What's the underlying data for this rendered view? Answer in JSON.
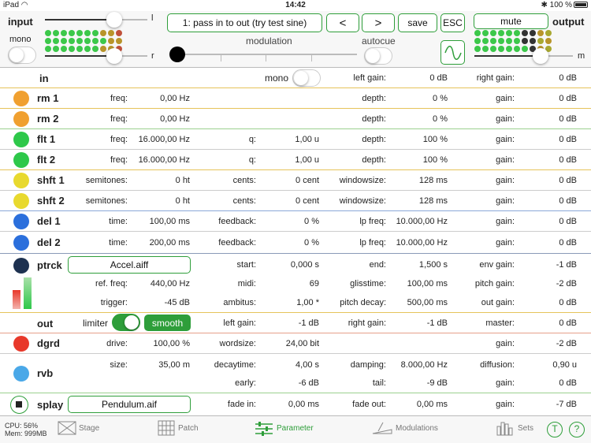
{
  "status": {
    "device": "iPad",
    "time": "14:42",
    "battery": "100 %"
  },
  "top": {
    "input_label": "input",
    "mono_label": "mono",
    "l": "l",
    "r": "r",
    "preset": "1: pass in to out (try test sine)",
    "prev": "<",
    "next": ">",
    "save": "save",
    "esc": "ESC",
    "modulation": "modulation",
    "autocue": "autocue",
    "mute": "mute",
    "output": "output",
    "m": "m",
    "colors": {
      "accent": "#2e9e3a"
    }
  },
  "rows": {
    "in": {
      "name": "in",
      "mono": "mono",
      "lg_l": "left gain:",
      "lg_v": "0 dB",
      "rg_l": "right gain:",
      "rg_v": "0 dB"
    },
    "rm1": {
      "name": "rm 1",
      "a_l": "freq:",
      "a_v": "0,00 Hz",
      "c_l": "depth:",
      "c_v": "0 %",
      "d_l": "gain:",
      "d_v": "0 dB"
    },
    "rm2": {
      "name": "rm 2",
      "a_l": "freq:",
      "a_v": "0,00 Hz",
      "c_l": "depth:",
      "c_v": "0 %",
      "d_l": "gain:",
      "d_v": "0 dB"
    },
    "flt1": {
      "name": "flt 1",
      "a_l": "freq:",
      "a_v": "16.000,00 Hz",
      "b_l": "q:",
      "b_v": "1,00 u",
      "c_l": "depth:",
      "c_v": "100 %",
      "d_l": "gain:",
      "d_v": "0 dB"
    },
    "flt2": {
      "name": "flt 2",
      "a_l": "freq:",
      "a_v": "16.000,00 Hz",
      "b_l": "q:",
      "b_v": "1,00 u",
      "c_l": "depth:",
      "c_v": "100 %",
      "d_l": "gain:",
      "d_v": "0 dB"
    },
    "shft1": {
      "name": "shft 1",
      "a_l": "semitones:",
      "a_v": "0 ht",
      "b_l": "cents:",
      "b_v": "0 cent",
      "c_l": "windowsize:",
      "c_v": "128 ms",
      "d_l": "gain:",
      "d_v": "0 dB"
    },
    "shft2": {
      "name": "shft 2",
      "a_l": "semitones:",
      "a_v": "0 ht",
      "b_l": "cents:",
      "b_v": "0 cent",
      "c_l": "windowsize:",
      "c_v": "128 ms",
      "d_l": "gain:",
      "d_v": "0 dB"
    },
    "del1": {
      "name": "del 1",
      "a_l": "time:",
      "a_v": "100,00 ms",
      "b_l": "feedback:",
      "b_v": "0 %",
      "c_l": "lp freq:",
      "c_v": "10.000,00 Hz",
      "d_l": "gain:",
      "d_v": "0 dB"
    },
    "del2": {
      "name": "del 2",
      "a_l": "time:",
      "a_v": "200,00 ms",
      "b_l": "feedback:",
      "b_v": "0 %",
      "c_l": "lp freq:",
      "c_v": "10.000,00 Hz",
      "d_l": "gain:",
      "d_v": "0 dB"
    },
    "ptrck": {
      "name": "ptrck",
      "file": "Accel.aiff",
      "start_l": "start:",
      "start_v": "0,000 s",
      "end_l": "end:",
      "end_v": "1,500 s",
      "env_l": "env gain:",
      "env_v": "-1 dB",
      "ref_l": "ref. freq:",
      "ref_v": "440,00 Hz",
      "midi_l": "midi:",
      "midi_v": "69",
      "gl_l": "glisstime:",
      "gl_v": "100,00 ms",
      "pg_l": "pitch gain:",
      "pg_v": "-2 dB",
      "tr_l": "trigger:",
      "tr_v": "-45 dB",
      "amb_l": "ambitus:",
      "amb_v": "1,00 *",
      "pd_l": "pitch decay:",
      "pd_v": "500,00 ms",
      "og_l": "out gain:",
      "og_v": "0 dB"
    },
    "out": {
      "name": "out",
      "limiter": "limiter",
      "smooth": "smooth",
      "lg_l": "left gain:",
      "lg_v": "-1 dB",
      "rg_l": "right gain:",
      "rg_v": "-1 dB",
      "m_l": "master:",
      "m_v": "0 dB"
    },
    "dgrd": {
      "name": "dgrd",
      "a_l": "drive:",
      "a_v": "100,00 %",
      "b_l": "wordsize:",
      "b_v": "24,00 bit",
      "d_l": "gain:",
      "d_v": "-2 dB"
    },
    "rvb": {
      "name": "rvb",
      "a_l": "size:",
      "a_v": "35,00 m",
      "b_l": "decaytime:",
      "b_v": "4,00 s",
      "c_l": "damping:",
      "c_v": "8.000,00 Hz",
      "d_l": "diffusion:",
      "d_v": "0,90 u",
      "e_l": "early:",
      "e_v": "-6 dB",
      "f_l": "tail:",
      "f_v": "-9 dB",
      "g_l": "gain:",
      "g_v": "0 dB"
    },
    "splay": {
      "name": "splay",
      "file": "Pendulum.aif",
      "a_l": "fade in:",
      "a_v": "0,00 ms",
      "c_l": "fade out:",
      "c_v": "0,00 ms",
      "d_l": "gain:",
      "d_v": "-7 dB"
    }
  },
  "tabbar": {
    "cpu": "CPU: 56%",
    "mem": "Mem: 999MB",
    "stage": "Stage",
    "patch": "Patch",
    "parameter": "Parameter",
    "modulations": "Modulations",
    "sets": "Sets",
    "t": "T",
    "q": "?"
  }
}
